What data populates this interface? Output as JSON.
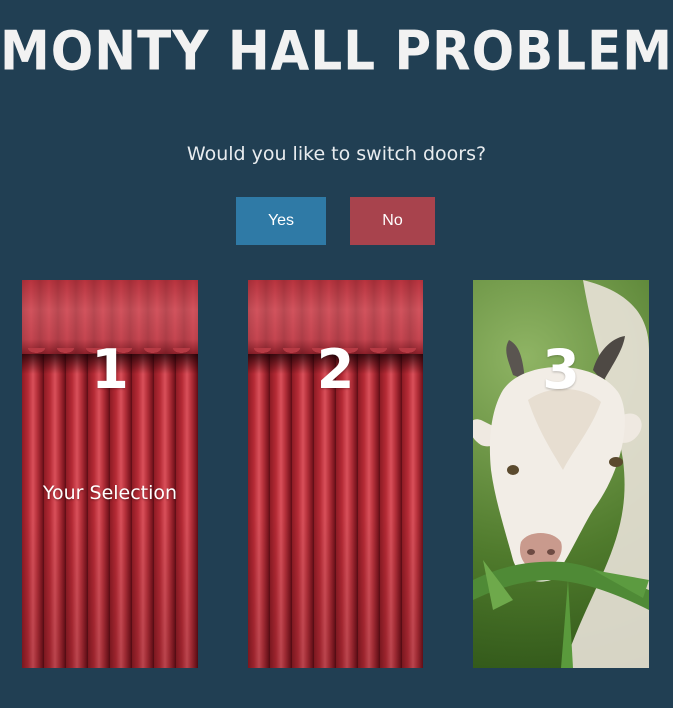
{
  "header": {
    "title": "MONTY HALL PROBLEM"
  },
  "prompt": {
    "question": "Would you like to switch doors?"
  },
  "actions": {
    "yes_label": "Yes",
    "no_label": "No"
  },
  "doors": [
    {
      "number": "1",
      "label": "Your Selection",
      "state": "closed",
      "image": "curtain"
    },
    {
      "number": "2",
      "label": "",
      "state": "closed",
      "image": "curtain"
    },
    {
      "number": "3",
      "label": "",
      "state": "open",
      "image": "goat"
    }
  ],
  "colors": {
    "background": "#213f53",
    "yes_button": "#2f7aa6",
    "no_button": "#a8434d",
    "curtain": "#b52a35"
  }
}
